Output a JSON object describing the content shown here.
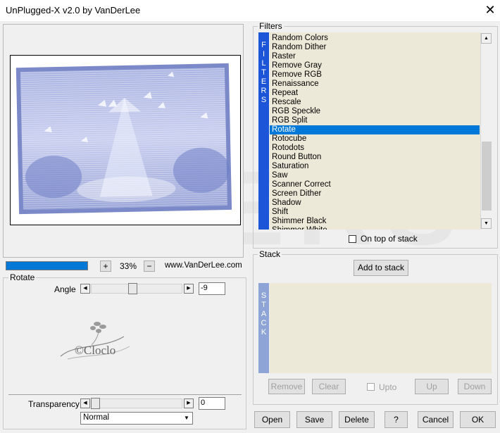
{
  "window": {
    "title": "UnPlugged-X v2.0 by VanDerLee",
    "close_glyph": "✕"
  },
  "watermark": "D VERS",
  "preview": {
    "zoom_in": "+",
    "zoom_out": "−",
    "zoom_level": "33%",
    "website": "www.VanDerLee.com",
    "progress": 1.0
  },
  "rotate_panel": {
    "title": "Rotate",
    "angle_label": "Angle",
    "angle_value": "-9",
    "angle_slider_fraction": 0.45,
    "logo_text": "©Cloclo"
  },
  "transparency": {
    "label": "Transparency",
    "value": "0",
    "slider_fraction": 0.0,
    "blend_mode": "Normal"
  },
  "filters": {
    "title": "Filters",
    "side_label": [
      "F",
      "I",
      "L",
      "T",
      "E",
      "R",
      "S"
    ],
    "items": [
      "Random Colors",
      "Random Dither",
      "Raster",
      "Remove Gray",
      "Remove RGB",
      "Renaissance",
      "Repeat",
      "Rescale",
      "RGB Speckle",
      "RGB Split",
      "Rotate",
      "Rotocube",
      "Rotodots",
      "Round Button",
      "Saturation",
      "Saw",
      "Scanner Correct",
      "Screen Dither",
      "Shadow",
      "Shift",
      "Shimmer Black",
      "Shimmer White"
    ],
    "selected": "Rotate",
    "on_top_label": "On top of stack"
  },
  "stack": {
    "title": "Stack",
    "side_label": [
      "S",
      "T",
      "A",
      "C",
      "K"
    ],
    "add_button": "Add to stack",
    "remove_button": "Remove",
    "clear_button": "Clear",
    "upto_label": "Upto",
    "up_button": "Up",
    "down_button": "Down"
  },
  "footer": {
    "open": "Open",
    "save": "Save",
    "delete": "Delete",
    "help": "?",
    "cancel": "Cancel",
    "ok": "OK"
  },
  "colors": {
    "accent": "#0078d7",
    "filter_bar": "#1c55d8",
    "stack_bar": "#8fa4d6",
    "list_bg": "#ede9d8"
  }
}
